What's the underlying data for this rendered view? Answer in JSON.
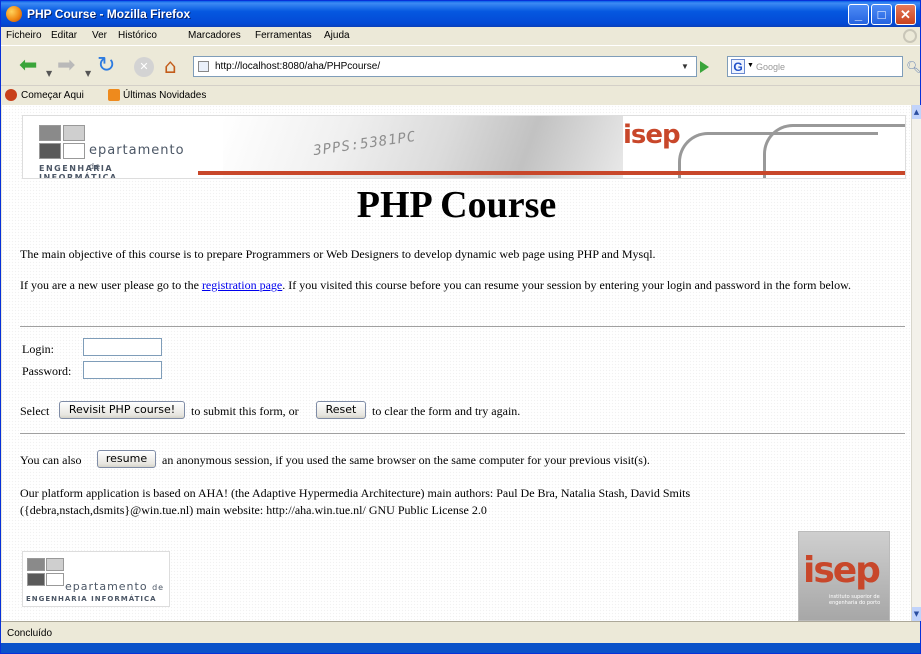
{
  "window": {
    "title": "PHP Course - Mozilla Firefox",
    "minimize": "_",
    "maximize": "□",
    "close": "✕"
  },
  "menu": {
    "items": [
      "Ficheiro",
      "Editar",
      "Ver",
      "Histórico",
      "Marcadores",
      "Ferramentas",
      "Ajuda"
    ]
  },
  "toolbar": {
    "url": "http://localhost:8080/aha/PHPcourse/",
    "search_placeholder": "Google",
    "search_engine_letter": "G",
    "icons": [
      "back-arrow-icon",
      "forward-arrow-icon",
      "reload-icon",
      "stop-icon",
      "home-icon",
      "go-arrow-icon",
      "search-magnifier-icon"
    ]
  },
  "bookmarks": {
    "items": [
      "Começar Aqui",
      "Últimas Novidades"
    ]
  },
  "header": {
    "logo_text_dept": "epartamento",
    "logo_text_de": "de",
    "logo_subtext": "ENGENHARIA INFORMÁTICA",
    "banner_code": "3PPS:5381PC",
    "isep": "isep"
  },
  "main": {
    "title": "PHP Course",
    "intro": "The main objective of this course is to prepare Programmers or Web Designers to develop dynamic web page using PHP and Mysql.",
    "new_user_before": "If you are a new user please go to the ",
    "registration_link": "registration page",
    "new_user_after": ". If you visited this course before you can resume your session by entering your login and password in the form below.",
    "form": {
      "login_label": "Login:",
      "password_label": "Password:",
      "login_value": "",
      "password_value": "",
      "select_text": "Select",
      "submit_button": "Revisit PHP course!",
      "submit_after": "to submit this form, or",
      "reset_button": "Reset",
      "reset_after": "to clear the form and try again."
    },
    "also_text": "You can also",
    "resume_button": "resume",
    "also_after": "an anonymous session, if you used the same browser on the same computer for your previous visit(s).",
    "platform_line1": "Our platform application is based on AHA! (the Adaptive Hypermedia Architecture) main authors: Paul De Bra, Natalia Stash, David Smits",
    "platform_line2": "({debra,nstach,dsmits}@win.tue.nl) main website: http://aha.win.tue.nl/ GNU Public License 2.0"
  },
  "footer": {
    "isep": "isep",
    "isep_sub": "instituto superior de engenharia do porto"
  },
  "status": {
    "text": "Concluído"
  },
  "colors": {
    "titlebar": "#0558e0",
    "link": "#0000ee",
    "isep_red": "#c8472a"
  }
}
